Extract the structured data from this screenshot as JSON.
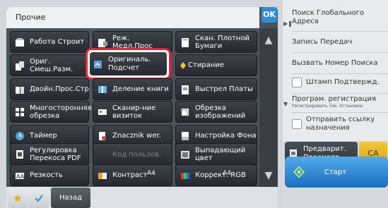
{
  "header": {
    "title": "Прочие",
    "ok_label": "OK"
  },
  "grid": [
    {
      "label": "Работа Строит",
      "icon": "job-build-icon"
    },
    {
      "label": "Реж. Медл.Прос",
      "icon": "slow-scan-icon"
    },
    {
      "label": "Скан. Плотной Бумаги",
      "icon": "thick-paper-icon"
    },
    {
      "label": "Ориг. Смеш.Разм.",
      "icon": "mixed-size-icon"
    },
    {
      "label": "Оригиналь. Подсчет",
      "icon": "original-count-icon"
    },
    {
      "label": "Стирание",
      "icon": "erase-icon"
    },
    {
      "label": "Двойн.Прос.Стр",
      "icon": "dual-page-icon"
    },
    {
      "label": "Деление книги",
      "icon": "book-divide-icon"
    },
    {
      "label": "Выстрел Платы",
      "icon": "card-shot-icon"
    },
    {
      "label": "Многосторонняя обрезка",
      "icon": "multi-crop-icon"
    },
    {
      "label": "Сканир-ние визиток",
      "icon": "business-card-icon"
    },
    {
      "label": "Обрезка изображений",
      "icon": "image-crop-icon"
    },
    {
      "label": "Таймер",
      "icon": "timer-icon"
    },
    {
      "label": "Znacznik wer.",
      "icon": "verification-stamp-icon"
    },
    {
      "label": "Настройка Фона",
      "icon": "background-icon"
    },
    {
      "label": "Регулировка Перекоса PDF",
      "icon": "skew-adjust-icon"
    },
    {
      "label": "Код пользов.",
      "icon": "user-code-icon"
    },
    {
      "label": "Выпадающий цвет",
      "icon": "dropout-color-icon"
    },
    {
      "label": "Резкость",
      "icon": "sharpness-icon"
    },
    {
      "label": "Контраст",
      "icon": "contrast-icon"
    },
    {
      "label": "Коррект. RGB",
      "icon": "rgb-adjust-icon"
    }
  ],
  "scroll": {
    "up_icon": "scroll-up-icon",
    "down_icon": "scroll-down-icon"
  },
  "paper": {
    "a4_1": "A4",
    "a4_2": "A4"
  },
  "bottom": {
    "back_label": "Назад",
    "star_icon": "star-icon",
    "check_icon": "check-icon"
  },
  "right_panel": {
    "global_search": "Поиск Глобального Адреса",
    "record_transfers": "Запись Передач",
    "call_search_number": "Вызвать Номер Поиска",
    "stamp_confirm": "Штамп Подтвержд.",
    "program_register": "Програм. регистрация",
    "program_register_sub": "Регистрировать Тек. Установки",
    "send_link": "Отправить ссылку назначения",
    "preview": "Предварит. Просмотр",
    "ca": "CA",
    "start": "Старт"
  }
}
